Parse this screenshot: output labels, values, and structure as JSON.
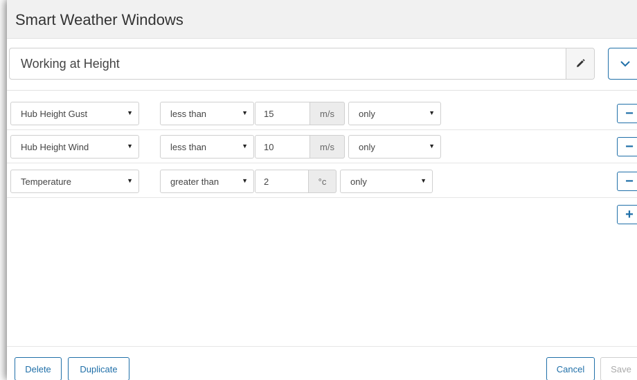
{
  "window": {
    "title": "Smart Weather Windows"
  },
  "rule_set": {
    "name": "Working at Height"
  },
  "icons": {
    "edit": "pencil-icon",
    "collapse": "chevron-down-icon",
    "remove": "minus-icon",
    "add": "plus-icon"
  },
  "conditions": [
    {
      "parameter": "Hub Height Gust",
      "operator": "less than",
      "value": "15",
      "unit": "m/s",
      "qualifier": "only"
    },
    {
      "parameter": "Hub Height Wind",
      "operator": "less than",
      "value": "10",
      "unit": "m/s",
      "qualifier": "only"
    },
    {
      "parameter": "Temperature",
      "operator": "greater than",
      "value": "2",
      "unit": "°c",
      "qualifier": "only"
    }
  ],
  "buttons": {
    "remove": "−",
    "add": "+"
  },
  "footer": {
    "delete": "Delete",
    "duplicate": "Duplicate",
    "cancel": "Cancel",
    "save": "Save"
  },
  "colors": {
    "accent": "#1f6fa8",
    "header_bg": "#f1f1f1",
    "unit_bg": "#ececec"
  }
}
